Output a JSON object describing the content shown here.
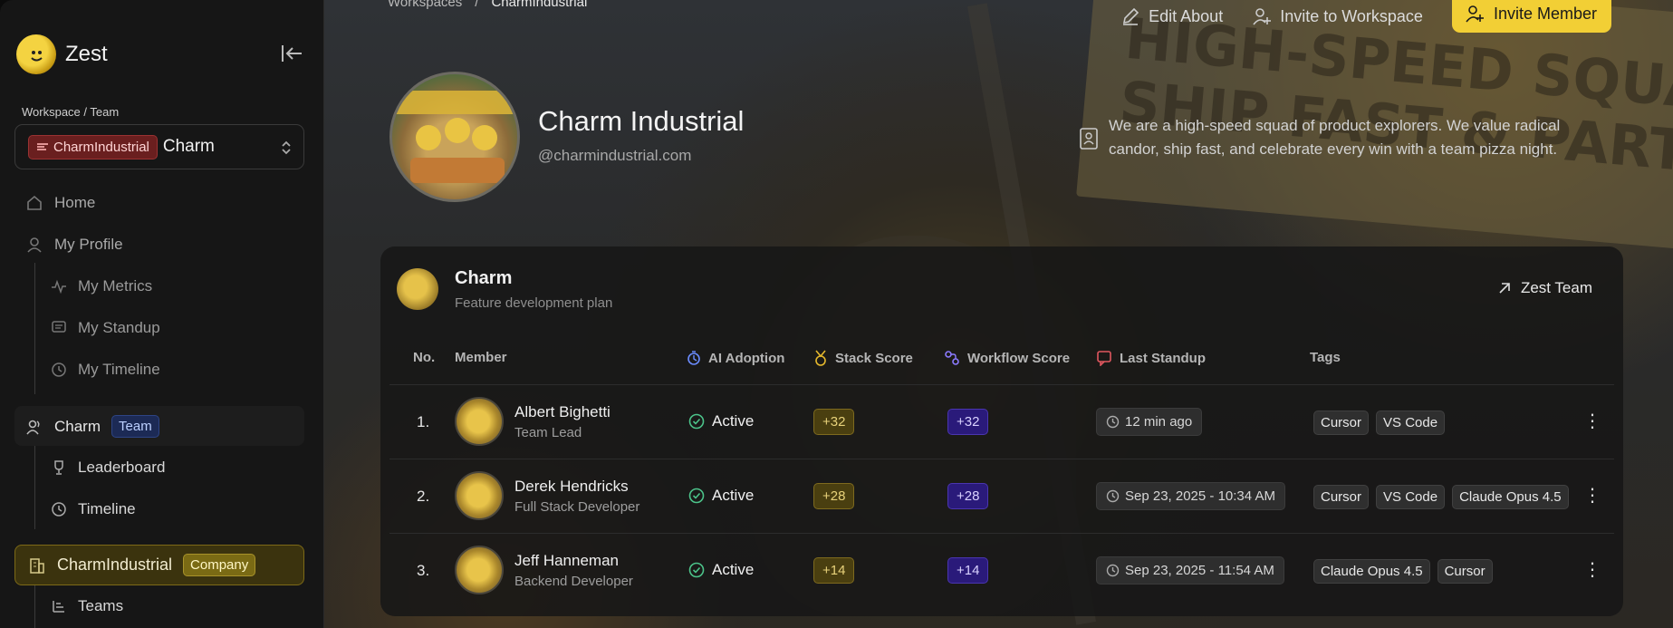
{
  "sidebar": {
    "brand": "Zest",
    "workspace_label": "Workspace / Team",
    "workspace_chip": "CharmIndustrial",
    "workspace_value": "Charm",
    "nav": {
      "home": "Home",
      "my_profile": "My Profile",
      "my_metrics": "My Metrics",
      "my_standup": "My Standup",
      "my_timeline": "My Timeline",
      "team_name": "Charm",
      "team_tag": "Team",
      "leaderboard": "Leaderboard",
      "timeline": "Timeline",
      "company_name": "CharmIndustrial",
      "company_tag": "Company",
      "teams": "Teams"
    }
  },
  "breadcrumb": {
    "parent": "Workspaces",
    "separator": "/",
    "current": "CharmIndustrial"
  },
  "actions": {
    "edit_about": "Edit About",
    "invite_workspace": "Invite to Workspace",
    "invite_member": "Invite Member"
  },
  "company": {
    "name": "Charm Industrial",
    "handle": "@charmindustrial.com",
    "about": "We are a high-speed squad of product explorers. We value radical candor, ship fast, and celebrate every win with a team pizza night."
  },
  "background": {
    "banner_line1": "HIGH-SPEED SQUA",
    "banner_line2": "SHIP FAST & PARTY H"
  },
  "team_card": {
    "name": "Charm",
    "subtitle": "Feature development plan",
    "link": "Zest Team",
    "columns": {
      "no": "No.",
      "member": "Member",
      "ai_adoption": "AI Adoption",
      "stack_score": "Stack Score",
      "workflow_score": "Workflow Score",
      "last_standup": "Last Standup",
      "tags": "Tags"
    },
    "rows": [
      {
        "no": "1.",
        "name": "Albert Bighetti",
        "role": "Team Lead",
        "status": "Active",
        "stack": "+32",
        "workflow": "+32",
        "standup": "12 min ago",
        "tags": [
          "Cursor",
          "VS Code"
        ]
      },
      {
        "no": "2.",
        "name": "Derek Hendricks",
        "role": "Full Stack Developer",
        "status": "Active",
        "stack": "+28",
        "workflow": "+28",
        "standup": "Sep 23, 2025 - 10:34 AM",
        "tags": [
          "Cursor",
          "VS Code",
          "Claude Opus 4.5"
        ]
      },
      {
        "no": "3.",
        "name": "Jeff Hanneman",
        "role": "Backend Developer",
        "status": "Active",
        "stack": "+14",
        "workflow": "+14",
        "standup": "Sep 23, 2025 - 11:54 AM",
        "tags": [
          "Claude Opus 4.5",
          "Cursor"
        ]
      }
    ]
  },
  "colors": {
    "accent": "#f2cf35",
    "active_green": "#4cc38a",
    "workflow_purple": "#2a1a7a",
    "stack_gold": "#4a3f10"
  }
}
